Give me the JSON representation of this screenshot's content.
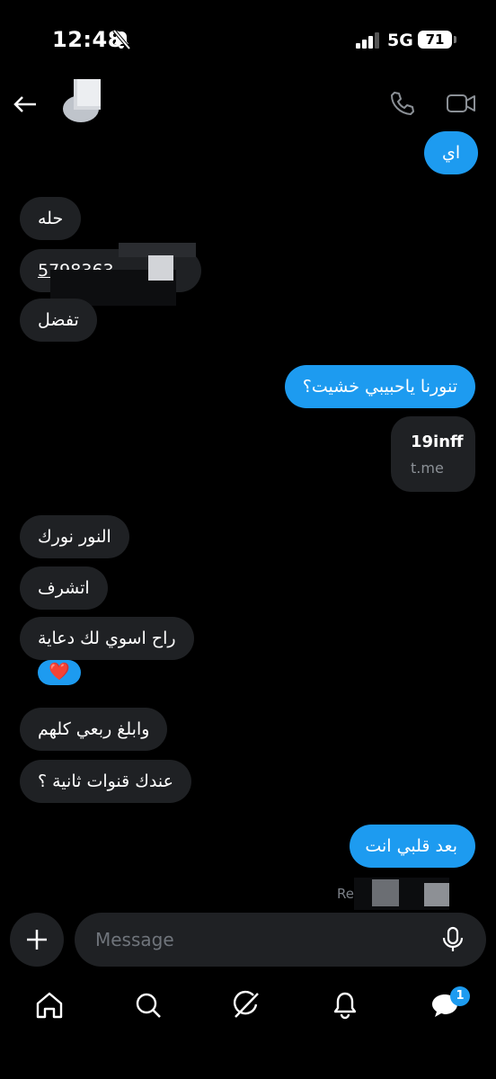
{
  "status_bar": {
    "time": "12:48",
    "network": "5G",
    "battery": "71"
  },
  "conversation": {
    "messages": [
      {
        "side": "out",
        "text": "اي"
      },
      {
        "side": "in",
        "text": "حله"
      },
      {
        "side": "in",
        "text": "5798363"
      },
      {
        "side": "in",
        "text": "تفضل"
      },
      {
        "side": "out",
        "text": "تنورنا ياحبيبي خشيت؟"
      },
      {
        "side": "out",
        "link_title": "19inff",
        "link_domain": "t.me"
      },
      {
        "side": "in",
        "text": "النور نورك"
      },
      {
        "side": "in",
        "text": "اتشرف"
      },
      {
        "side": "in",
        "text": "راح اسوي لك دعاية",
        "reaction": "❤️"
      },
      {
        "side": "in",
        "text": "وابلغ ربعي كلهم"
      },
      {
        "side": "in",
        "text": "عندك قنوات ثانية ؟"
      },
      {
        "side": "out",
        "text": "بعد قلبي انت"
      }
    ],
    "read_status": "Re"
  },
  "composer": {
    "placeholder": "Message"
  },
  "tab_bar": {
    "items": [
      {
        "icon": "home-icon"
      },
      {
        "icon": "search-icon"
      },
      {
        "icon": "grok-icon"
      },
      {
        "icon": "notifications-icon"
      },
      {
        "icon": "messages-icon",
        "badge": "1"
      }
    ]
  },
  "colors": {
    "accent": "#1d9bf0",
    "incoming_bubble": "#1f2124",
    "background": "#000000"
  }
}
